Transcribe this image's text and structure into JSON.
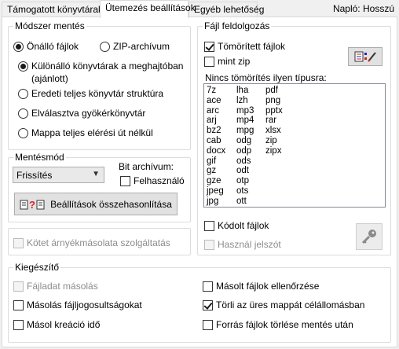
{
  "tabs": [
    {
      "label": "Támogatott könyvtárak",
      "active": false
    },
    {
      "label": "Ütemezés beállítások",
      "active": true
    },
    {
      "label": "Egyéb lehetőség",
      "active": false
    }
  ],
  "log_label": "Napló: Hosszú",
  "method": {
    "title": "Módszer mentés",
    "standalone": "Önálló fájlok",
    "zip": "ZIP-archívum",
    "separate_dirs": "Különálló könyvtárak a meghajtóban",
    "recommended": "(ajánlott)",
    "full_structure": "Eredeti teljes könyvtár struktúra",
    "separated_root": "Elválasztva gyökérkönyvtár",
    "full_path": "Mappa teljes elérési út nélkül"
  },
  "save_mode": {
    "title": "Mentésmód",
    "selected": "Frissítés",
    "archive_bit_label": "Bit archívum:",
    "use_label": "Felhasználó",
    "compare_button": "Beállítások összehasonlítása"
  },
  "shadow_copy": "Kötet árnyékmásolata szolgáltatás",
  "compression": {
    "title": "Fájl feldolgozás",
    "compressed": "Tömörített fájlok",
    "mint_zip": "mint zip",
    "no_compress_label": "Nincs tömörítés ilyen típusra:",
    "ext_col1": [
      "7z",
      "ace",
      "arc",
      "arj",
      "bz2",
      "cab",
      "docx",
      "gif",
      "gz",
      "gze",
      "jpeg",
      "jpg"
    ],
    "ext_col2": [
      "lha",
      "lzh",
      "mp3",
      "mp4",
      "mpg",
      "odg",
      "odp",
      "ods",
      "odt",
      "otp",
      "ots",
      "ott"
    ],
    "ext_col3": [
      "pdf",
      "png",
      "pptx",
      "rar",
      "xlsx",
      "zip",
      "zipx"
    ],
    "encoded": "Kódolt fájlok",
    "use_password": "Használ jelszót"
  },
  "extra": {
    "title": "Kiegészítő",
    "copy_file_data": "Fájladat másolás",
    "copy_permissions": "Másolás fájljogosultságokat",
    "copy_creation": "Másol kreáció idő",
    "verify_copied": "Másolt fájlok ellenőrzése",
    "delete_empty": "Törli az üres mappát célállomásban",
    "delete_source": "Forrás fájlok törlése mentés után"
  }
}
